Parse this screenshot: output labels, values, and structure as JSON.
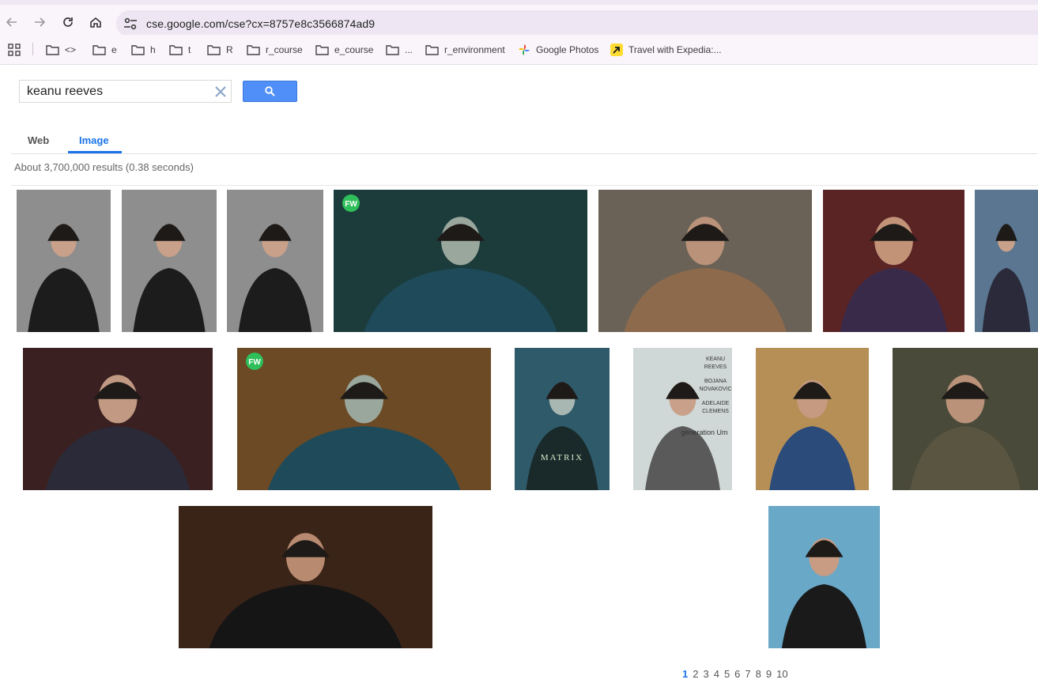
{
  "browser": {
    "url": "cse.google.com/cse?cx=8757e8c3566874ad9",
    "bookmarks": [
      {
        "label": "<>",
        "icon": "folder-icon"
      },
      {
        "label": "e",
        "icon": "folder-icon"
      },
      {
        "label": "h",
        "icon": "folder-icon"
      },
      {
        "label": "t",
        "icon": "folder-icon"
      },
      {
        "label": "R",
        "icon": "folder-icon"
      },
      {
        "label": "r_course",
        "icon": "folder-icon"
      },
      {
        "label": "e_course",
        "icon": "folder-icon"
      },
      {
        "label": "...",
        "icon": "folder-icon"
      },
      {
        "label": "r_environment",
        "icon": "folder-icon"
      },
      {
        "label": "Google Photos",
        "icon": "google-photos-icon"
      },
      {
        "label": "Travel with Expedia:...",
        "icon": "expedia-icon"
      }
    ]
  },
  "search": {
    "query": "keanu reeves"
  },
  "tabs": [
    {
      "label": "Web",
      "active": false
    },
    {
      "label": "Image",
      "active": true
    }
  ],
  "results_info": "About 3,700,000 results (0.38 seconds)",
  "images": [
    {
      "name": "image-result-1",
      "bg": "#8e8e8e",
      "fg": "#1c1c1c",
      "skin": "#c9a08a"
    },
    {
      "name": "image-result-2",
      "bg": "#8e8e8e",
      "fg": "#1c1c1c",
      "skin": "#c9a08a"
    },
    {
      "name": "image-result-3",
      "bg": "#8e8e8e",
      "fg": "#1c1c1c",
      "skin": "#c9a08a"
    },
    {
      "name": "image-result-4",
      "bg": "#1c3c3c",
      "fg": "#1f4a5a",
      "skin": "#9aa79c"
    },
    {
      "name": "image-result-5",
      "bg": "#6b6257",
      "fg": "#8d6a4c",
      "skin": "#b99279"
    },
    {
      "name": "image-result-6",
      "bg": "#5a2424",
      "fg": "#3a2a4a",
      "skin": "#c39378"
    },
    {
      "name": "image-result-7",
      "bg": "#5a7690",
      "fg": "#2a2a3a",
      "skin": "#c9a08a"
    },
    {
      "name": "image-result-8",
      "bg": "#3a2020",
      "fg": "#2a2a38",
      "skin": "#c29a83"
    },
    {
      "name": "image-result-9",
      "bg": "#6b4a25",
      "fg": "#1f4a5a",
      "skin": "#9aa79c"
    },
    {
      "name": "image-result-10",
      "bg": "#2f5a6a",
      "fg": "#1a2a2a",
      "skin": "#a9b7b2"
    },
    {
      "name": "image-result-11",
      "bg": "#cfd8d6",
      "fg": "#5a5a5a",
      "skin": "#c9a08a"
    },
    {
      "name": "image-result-12",
      "bg": "#b68f57",
      "fg": "#2b4b7a",
      "skin": "#c59a80"
    },
    {
      "name": "image-result-13",
      "bg": "#4a4a3a",
      "fg": "#5a5540",
      "skin": "#b99279"
    },
    {
      "name": "image-result-14",
      "bg": "#3a2418",
      "fg": "#151515",
      "skin": "#b88a70"
    },
    {
      "name": "image-result-15",
      "bg": "#6aa8c8",
      "fg": "#1a1a1a",
      "skin": "#c89c82"
    }
  ],
  "matrix_poster_text": "MATRIX",
  "poster_text": [
    "KEANU",
    "REEVES",
    "BOJANA",
    "NOVAKOVIC",
    "ADELAIDE",
    "CLEMENS",
    "generation Um"
  ],
  "pagination": [
    "1",
    "2",
    "3",
    "4",
    "5",
    "6",
    "7",
    "8",
    "9",
    "10"
  ],
  "colors": {
    "accent": "#1a73e8",
    "search_button": "#4f8ff7",
    "chrome_bg": "#faf4fb"
  }
}
